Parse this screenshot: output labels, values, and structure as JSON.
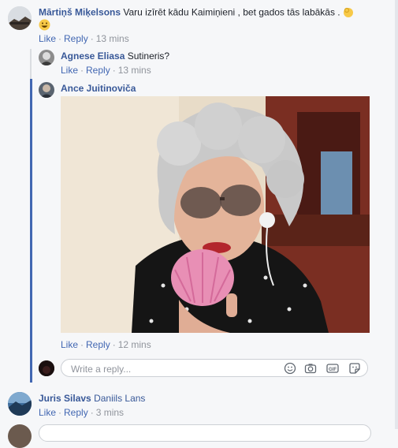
{
  "comments": [
    {
      "author": "Mārtiņš Miķelsons",
      "text": "Varu izīrēt kādu Kaimiņieni , bet gados tās labākās .",
      "like": "Like",
      "reply": "Reply",
      "time": "13 mins"
    },
    {
      "author": "Agnese Eliasa",
      "text": "Sutineris?",
      "like": "Like",
      "reply": "Reply",
      "time": "13 mins"
    },
    {
      "author": "Ance Juitinoviča",
      "like": "Like",
      "reply": "Reply",
      "time": "12 mins"
    },
    {
      "author": "Juris Silavs",
      "text": "Daniils Lans",
      "like": "Like",
      "reply": "Reply",
      "time": "3 mins"
    }
  ],
  "reply_box": {
    "placeholder": "Write a reply...",
    "icons": [
      "emoji-icon",
      "camera-icon",
      "gif-icon",
      "sticker-icon"
    ]
  },
  "colors": {
    "name": "#385898",
    "link": "#4267b2",
    "meta": "#90949c",
    "background": "#f6f7f9"
  }
}
